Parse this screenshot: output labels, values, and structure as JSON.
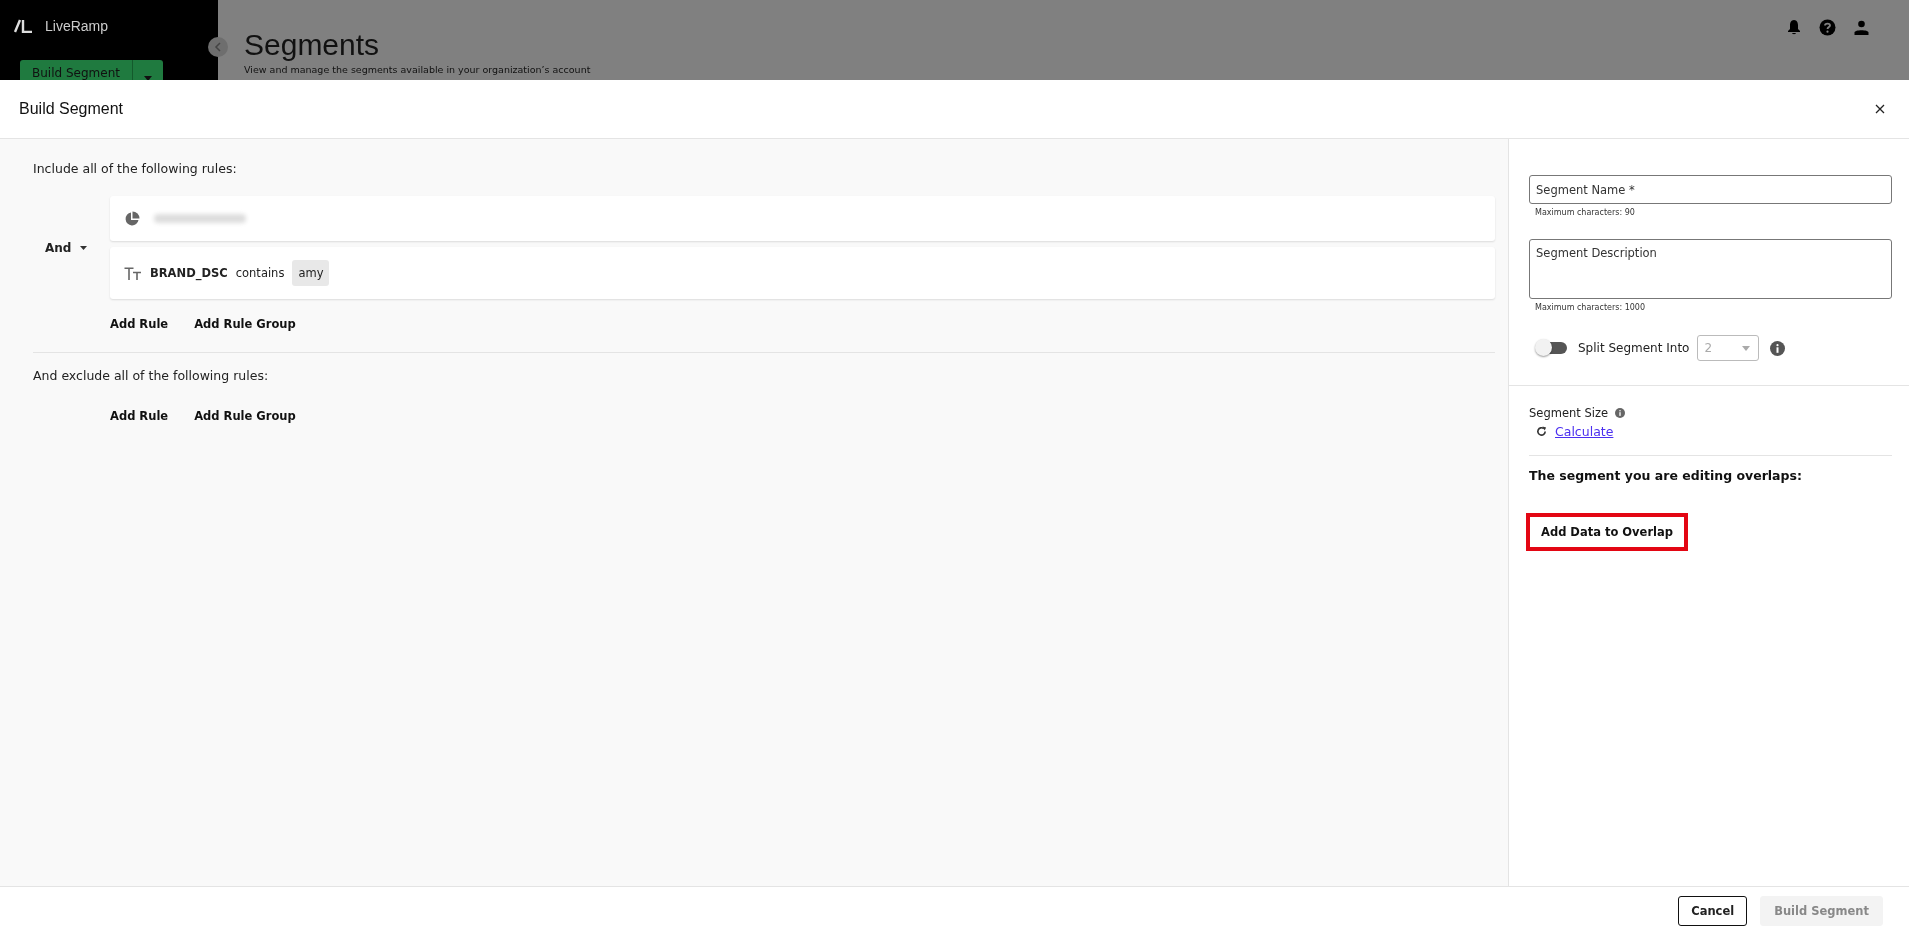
{
  "background": {
    "brand": "LiveRamp",
    "primary_button": "Build Segment",
    "page_title": "Segments",
    "page_subtitle": "View and manage the segments available in your organization’s account"
  },
  "modal": {
    "title": "Build Segment",
    "include": {
      "heading": "Include all of the following rules:",
      "operator": "And",
      "rules": [
        {
          "kind": "segment",
          "redacted": true
        },
        {
          "kind": "text",
          "field": "BRAND_DSC",
          "operator": "contains",
          "value": "amy"
        }
      ],
      "actions": [
        "Add Rule",
        "Add Rule Group"
      ]
    },
    "exclude": {
      "heading": "And exclude all of the following rules:",
      "actions": [
        "Add Rule",
        "Add Rule Group"
      ]
    },
    "form": {
      "name_field": {
        "placeholder": "Segment Name *",
        "hint": "Maximum characters: 90"
      },
      "description_field": {
        "placeholder": "Segment Description",
        "hint": "Maximum characters: 1000"
      },
      "split": {
        "label": "Split Segment Into",
        "on": false,
        "value": "2",
        "disabled": true
      }
    },
    "size": {
      "label": "Segment Size",
      "link": "Calculate"
    },
    "overlap": {
      "heading": "The segment you are editing overlaps:",
      "button": "Add Data to Overlap",
      "highlighted": true
    },
    "footer": [
      {
        "label": "Cancel",
        "disabled": false
      },
      {
        "label": "Build Segment",
        "disabled": true
      }
    ]
  }
}
